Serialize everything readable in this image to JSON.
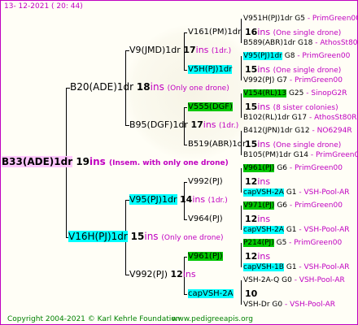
{
  "date": "13- 12-2021 ( 20: 44)",
  "copyright": "Copyright 2004-2021 © Karl Kehrle Foundation",
  "website": "www.pedigreeapis.org",
  "root": {
    "name": "B33(ADE)1dr",
    "ins_num": "19",
    "ins_word": "ins",
    "note": "(Insem. with only one drone)"
  },
  "gen1": [
    {
      "name": "B20(ADE)1dr",
      "ins_num": "18",
      "ins_word": "ins",
      "note": "(Only one drone)"
    },
    {
      "name": "V16H(PJ)1dr",
      "ins_num": "15",
      "ins_word": "ins",
      "note": "(Only one drone)"
    }
  ],
  "gen2": [
    {
      "name": "V9(JMD)1dr",
      "ins_num": "17",
      "ins_word": "ins",
      "note": "(1dr.)"
    },
    {
      "name": "B95(DGF)1dr",
      "ins_num": "17",
      "ins_word": "ins",
      "note": "(1dr.)"
    },
    {
      "name": "V95(PJ)1dr",
      "ins_num": "14",
      "ins_word": "ins",
      "note": "(1dr.)"
    },
    {
      "name": "V992(PJ)",
      "ins_num": "12",
      "ins_word": "ins",
      "note": ""
    }
  ],
  "gen3": [
    {
      "name": "V161(PM)1dr",
      "ins_num": "16",
      "ins_word": "ins",
      "note": "(One single drone)"
    },
    {
      "name": "V5H(PJ)1dr",
      "ins_num": "15",
      "ins_word": "ins",
      "note": "(One single drone)"
    },
    {
      "name": "V555(DGF)",
      "ins_num": "15",
      "ins_word": "ins",
      "note": "(8 sister colonies)"
    },
    {
      "name": "B519(ABR)1dr",
      "ins_num": "15",
      "ins_word": "ins",
      "note": "(One single drone)"
    },
    {
      "name": "V992(PJ)",
      "ins_num": "12",
      "ins_word": "ins",
      "note": ""
    },
    {
      "name": "V964(PJ)",
      "ins_num": "12",
      "ins_word": "ins",
      "note": ""
    },
    {
      "name": "V961(PJ)",
      "ins_num": "12",
      "ins_word": "ins",
      "note": ""
    },
    {
      "name": "capVSH-2A",
      "ins_num": "10",
      "ins_word": "",
      "note": ""
    }
  ],
  "gen4": [
    {
      "name": "V951H(PJ)1dr",
      "gid": "G5",
      "src": "- PrimGreen00"
    },
    {
      "name": "B589(ABR)1dr",
      "gid": "G18",
      "src": "- AthosSt80R"
    },
    {
      "name": "V95(PJ)1dr",
      "gid": "G8",
      "src": "- PrimGreen00"
    },
    {
      "name": "V992(PJ)",
      "gid": "G7",
      "src": "- PrimGreen00"
    },
    {
      "name": "V154(RL)13",
      "gid": "G25",
      "src": "- SinopG2R"
    },
    {
      "name": "B102(RL)1dr",
      "gid": "G17",
      "src": "- AthosSt80R"
    },
    {
      "name": "B412(JPN)1dr",
      "gid": "G12",
      "src": "- NO6294R"
    },
    {
      "name": "B105(PM)1dr",
      "gid": "G14",
      "src": "- PrimGreen00"
    },
    {
      "name": "V961(PJ)",
      "gid": "G6",
      "src": "- PrimGreen00"
    },
    {
      "name": "capVSH-2A",
      "gid": "G1",
      "src": "- VSH-Pool-AR"
    },
    {
      "name": "V971(PJ)",
      "gid": "G6",
      "src": "- PrimGreen00"
    },
    {
      "name": "capVSH-2A",
      "gid": "G1",
      "src": "- VSH-Pool-AR"
    },
    {
      "name": "P214(PJ)",
      "gid": "G5",
      "src": "- PrimGreen00"
    },
    {
      "name": "capVSH-1B",
      "gid": "G1",
      "src": "- VSH-Pool-AR"
    },
    {
      "name": "VSH-2A-Q",
      "gid": "G0",
      "src": "- VSH-Pool-AR"
    },
    {
      "name": "VSH-Dr",
      "gid": "G0",
      "src": "- VSH-Pool-AR"
    }
  ]
}
